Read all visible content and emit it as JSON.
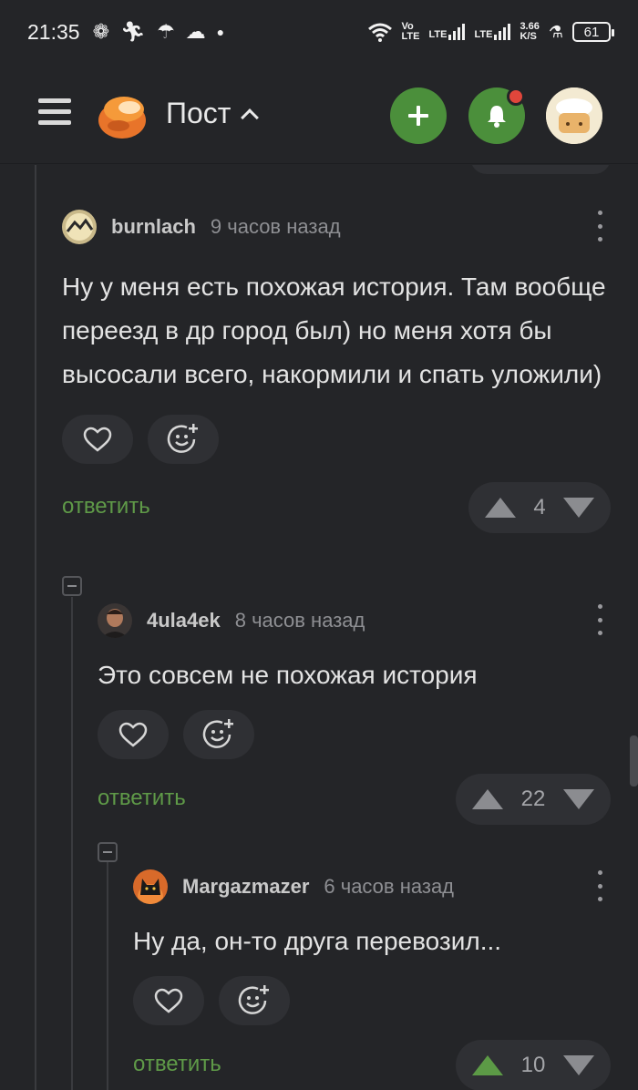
{
  "status_bar": {
    "time": "21:35",
    "lte1_top": "Vo",
    "lte1_bottom": "LTE",
    "lte2": "LTE",
    "lte3": "LTE",
    "speed_top": "3.66",
    "speed_bottom": "K/S",
    "battery": "61"
  },
  "header": {
    "title": "Пост",
    "add_icon": "plus-icon",
    "bell_icon": "bell-icon"
  },
  "comments": [
    {
      "username": "burnlach",
      "time": "9 часов назад",
      "text": "Ну у меня есть похожая история. Там вообще переезд в др город был) но меня хотя бы высосали всего, накормили и спать уложили)",
      "reply_label": "ответить",
      "votes": "4"
    },
    {
      "username": "4ula4ek",
      "time": "8 часов назад",
      "text": "Это совсем не похожая история",
      "reply_label": "ответить",
      "votes": "22"
    },
    {
      "username": "Margazmazer",
      "time": "6 часов назад",
      "text": "Ну да, он-то друга перевозил...",
      "reply_label": "ответить",
      "votes": "10"
    }
  ],
  "colors": {
    "background": "#242528",
    "accent_green": "#4b8f3b",
    "reply_green": "#5f9a48",
    "notification_red": "#e0463b"
  }
}
